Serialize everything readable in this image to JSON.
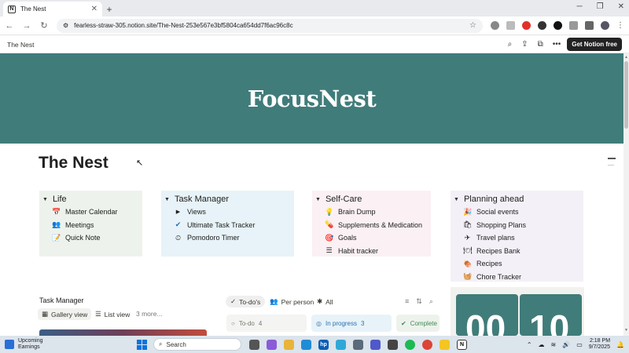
{
  "browser": {
    "tab_title": "The Nest",
    "tab_close": "✕",
    "new_tab": "+",
    "url": "fearless-straw-305.notion.site/The-Nest-253e567e3bf5804ca654dd7f6ac96c8c"
  },
  "notion": {
    "breadcrumb": "The Nest",
    "cta": "Get Notion free"
  },
  "cover": {
    "brand": "FocusNest",
    "color": "#407c7a"
  },
  "page": {
    "title": "The Nest"
  },
  "columns": [
    {
      "title": "Life",
      "bg": "#edf3ec",
      "items": [
        {
          "label": "Master Calendar",
          "icon": "calendar-icon"
        },
        {
          "label": "Meetings",
          "icon": "people-icon"
        },
        {
          "label": "Quick Note",
          "icon": "note-icon"
        }
      ]
    },
    {
      "title": "Task Manager",
      "bg": "#e7f3f8",
      "items": [
        {
          "label": "Views",
          "icon": "triangle-icon"
        },
        {
          "label": "Ultimate Task Tracker",
          "icon": "check-circle-icon"
        },
        {
          "label": "Pomodoro Timer",
          "icon": "timer-icon"
        }
      ]
    },
    {
      "title": "Self-Care",
      "bg": "#fbf0f3",
      "items": [
        {
          "label": "Brain Dump",
          "icon": "brain-icon"
        },
        {
          "label": "Supplements & Medication",
          "icon": "pill-icon"
        },
        {
          "label": "Goals",
          "icon": "goal-icon"
        },
        {
          "label": "Habit tracker",
          "icon": "list-icon"
        }
      ]
    },
    {
      "title": "Planning ahead",
      "bg": "#f4f0f7",
      "items": [
        {
          "label": "Social events",
          "icon": "party-icon"
        },
        {
          "label": "Shopping Plans",
          "icon": "bag-icon"
        },
        {
          "label": "Travel plans",
          "icon": "plane-icon"
        },
        {
          "label": "Recipes Bank",
          "icon": "plate-icon"
        },
        {
          "label": "Recipes",
          "icon": "food-icon"
        },
        {
          "label": "Chore Tracker",
          "icon": "iron-icon"
        }
      ]
    }
  ],
  "task_manager": {
    "label": "Task Manager",
    "views": [
      "Gallery view",
      "List view",
      "3 more..."
    ]
  },
  "board": {
    "tabs": [
      "To-do's",
      "Per person",
      "All"
    ],
    "columns": [
      {
        "name": "To-do",
        "count": "4",
        "bg": "#f4f4f2",
        "color": "#787774"
      },
      {
        "name": "In progress",
        "count": "3",
        "bg": "#e7f3f8",
        "color": "#2b6fb4"
      },
      {
        "name": "Complete",
        "count": "",
        "bg": "#edf3ec",
        "color": "#3d8a55"
      }
    ]
  },
  "timer": {
    "minutes": "00",
    "seconds": "10"
  },
  "taskbar": {
    "weather_title": "Upcoming",
    "weather_sub": "Earnings",
    "search_placeholder": "Search",
    "time": "2:18 PM",
    "date": "9/7/2025"
  }
}
